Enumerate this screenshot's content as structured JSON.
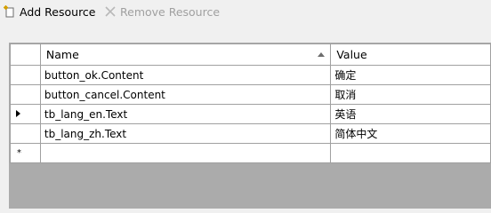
{
  "toolbar": {
    "add_label": "Add Resource",
    "remove_label": "Remove Resource"
  },
  "grid": {
    "columns": [
      "Name",
      "Value"
    ],
    "rows": [
      {
        "name": "button_ok.Content",
        "value": "确定"
      },
      {
        "name": "button_cancel.Content",
        "value": "取消"
      },
      {
        "name": "tb_lang_en.Text",
        "value": "英语"
      },
      {
        "name": "tb_lang_zh.Text",
        "value": "简体中文"
      }
    ],
    "current_row_index": 2,
    "new_row_marker": "*"
  },
  "colors": {
    "disabled_text": "#a0a0a0",
    "grid_background": "#ababab",
    "grid_line": "#a0a0a0"
  },
  "icons": {
    "add": "add-resource-icon",
    "remove": "remove-resource-icon",
    "sort": "sort-ascending-icon",
    "row_pointer": "current-row-pointer-icon"
  }
}
